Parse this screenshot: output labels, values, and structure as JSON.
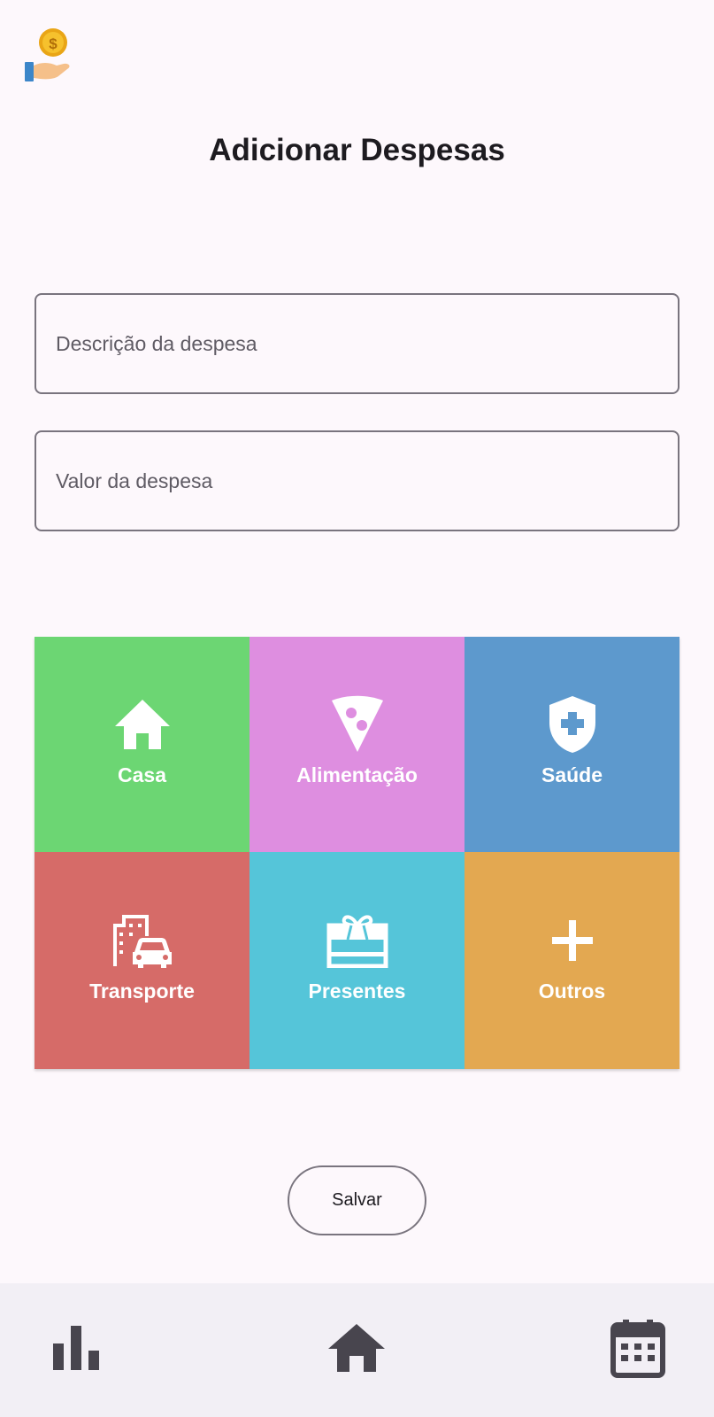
{
  "header": {
    "title": "Adicionar Despesas"
  },
  "form": {
    "description_placeholder": "Descrição da despesa",
    "value_placeholder": "Valor da despesa"
  },
  "categories": [
    {
      "label": "Casa",
      "icon": "home-icon",
      "color": "#6cd673"
    },
    {
      "label": "Alimentação",
      "icon": "pizza-icon",
      "color": "#de8ee0"
    },
    {
      "label": "Saúde",
      "icon": "health-shield-icon",
      "color": "#5d99cd"
    },
    {
      "label": "Transporte",
      "icon": "city-car-icon",
      "color": "#d66b68"
    },
    {
      "label": "Presentes",
      "icon": "gift-icon",
      "color": "#55c5d9"
    },
    {
      "label": "Outros",
      "icon": "plus-icon",
      "color": "#e3a851"
    }
  ],
  "actions": {
    "save_label": "Salvar"
  },
  "bottom_nav": {
    "items": [
      {
        "icon": "bar-chart-icon"
      },
      {
        "icon": "home-icon"
      },
      {
        "icon": "calendar-icon"
      }
    ],
    "icon_color": "#48454e"
  }
}
